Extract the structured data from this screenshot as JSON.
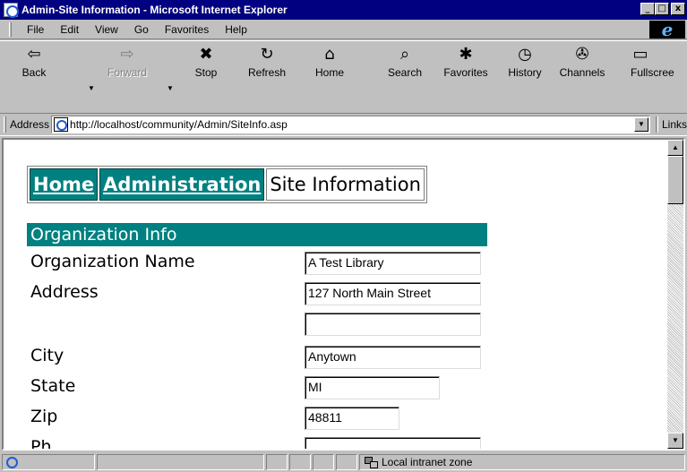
{
  "window": {
    "title": "Admin-Site Information - Microsoft Internet Explorer",
    "minimize": "_",
    "restore": "□",
    "close": "x"
  },
  "menu": [
    "File",
    "Edit",
    "View",
    "Go",
    "Favorites",
    "Help"
  ],
  "toolbar": {
    "buttons": [
      {
        "label": "Back",
        "icon": "back-arrow-icon",
        "glyph": "⇦"
      },
      {
        "label": "Forward",
        "icon": "forward-arrow-icon",
        "glyph": "⇨"
      },
      {
        "label": "Stop",
        "icon": "stop-icon",
        "glyph": "✖"
      },
      {
        "label": "Refresh",
        "icon": "refresh-icon",
        "glyph": "↻"
      },
      {
        "label": "Home",
        "icon": "home-icon",
        "glyph": "⌂"
      },
      {
        "label": "Search",
        "icon": "search-icon",
        "glyph": "⌕"
      },
      {
        "label": "Favorites",
        "icon": "favorites-icon",
        "glyph": "✱"
      },
      {
        "label": "History",
        "icon": "history-icon",
        "glyph": "◷"
      },
      {
        "label": "Channels",
        "icon": "channels-icon",
        "glyph": "✇"
      },
      {
        "label": "Fullscree",
        "icon": "fullscreen-icon",
        "glyph": "▭"
      }
    ]
  },
  "address": {
    "label": "Address",
    "url": "http://localhost/community/Admin/SiteInfo.asp",
    "links": "Links"
  },
  "page": {
    "breadcrumb": {
      "home": "Home",
      "administration": "Administration",
      "current": "Site Information"
    },
    "section_title": "Organization Info",
    "labels": {
      "org_name": "Organization Name",
      "address": "Address",
      "city": "City",
      "state": "State",
      "zip": "Zip",
      "phone_partial": "Ph"
    },
    "fields": {
      "org_name": "A Test Library",
      "address1": "127 North Main Street",
      "address2": "",
      "city": "Anytown",
      "state": "MI",
      "zip": "48811",
      "phone": ""
    }
  },
  "status": {
    "zone": "Local intranet zone"
  },
  "colors": {
    "titlebar": "#000080",
    "teal": "#008080",
    "chrome": "#c0c0c0"
  }
}
